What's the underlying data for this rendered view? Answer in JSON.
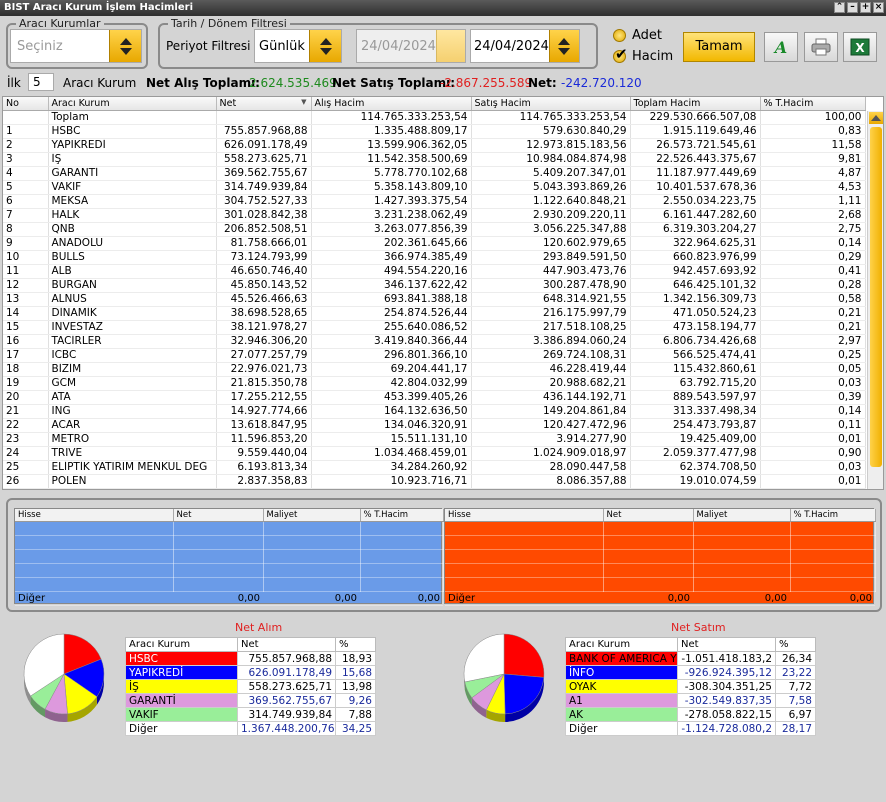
{
  "window": {
    "title": "BIST Aracı Kurum İşlem Hacimleri"
  },
  "brokers_group": {
    "legend": "Aracı Kurumlar",
    "combo_value": "Seçiniz"
  },
  "date_group": {
    "legend": "Tarih / Dönem Filtresi",
    "period_label": "Periyot Filtresi",
    "period_value": "Günlük",
    "date_from": "24/04/2024",
    "date_to": "24/04/2024"
  },
  "options": {
    "adet_label": "Adet",
    "hacim_label": "Hacim",
    "selected": "Hacim"
  },
  "toolbar": {
    "ok_label": "Tamam",
    "font_icon": "A",
    "print_icon": "printer-icon",
    "excel_icon": "excel-icon"
  },
  "info": {
    "ilk_label": "İlk",
    "ilk_value": "5",
    "broker_label": "Aracı Kurum",
    "net_buy_label": "Net Alış Toplamı:",
    "net_buy_value": "2.624.535.469",
    "net_sell_label": "Net Satış Toplamı:",
    "net_sell_value": "-2.867.255.589",
    "net_label": "Net:",
    "net_value": "-242.720.120"
  },
  "colors": {
    "buy": "#1e8a1e",
    "sell": "#e02020",
    "net": "#1a2ad8",
    "blue_panel": "#6a9be8",
    "orange_panel": "#ff4a00"
  },
  "grid": {
    "headers": [
      "No",
      "Aracı Kurum",
      "Net",
      "Alış Hacim",
      "Satış Hacim",
      "Toplam Hacim",
      "% T.Hacim"
    ],
    "rows": [
      [
        "",
        "Toplam",
        "",
        "114.765.333.253,54",
        "114.765.333.253,54",
        "229.530.666.507,08",
        "100,00"
      ],
      [
        "1",
        "HSBC",
        "755.857.968,88",
        "1.335.488.809,17",
        "579.630.840,29",
        "1.915.119.649,46",
        "0,83"
      ],
      [
        "2",
        "YAPIKREDİ",
        "626.091.178,49",
        "13.599.906.362,05",
        "12.973.815.183,56",
        "26.573.721.545,61",
        "11,58"
      ],
      [
        "3",
        "İŞ",
        "558.273.625,71",
        "11.542.358.500,69",
        "10.984.084.874,98",
        "22.526.443.375,67",
        "9,81"
      ],
      [
        "4",
        "GARANTİ",
        "369.562.755,67",
        "5.778.770.102,68",
        "5.409.207.347,01",
        "11.187.977.449,69",
        "4,87"
      ],
      [
        "5",
        "VAKIF",
        "314.749.939,84",
        "5.358.143.809,10",
        "5.043.393.869,26",
        "10.401.537.678,36",
        "4,53"
      ],
      [
        "6",
        "MEKSA",
        "304.752.527,33",
        "1.427.393.375,54",
        "1.122.640.848,21",
        "2.550.034.223,75",
        "1,11"
      ],
      [
        "7",
        "HALK",
        "301.028.842,38",
        "3.231.238.062,49",
        "2.930.209.220,11",
        "6.161.447.282,60",
        "2,68"
      ],
      [
        "8",
        "QNB",
        "206.852.508,51",
        "3.263.077.856,39",
        "3.056.225.347,88",
        "6.319.303.204,27",
        "2,75"
      ],
      [
        "9",
        "ANADOLU",
        "81.758.666,01",
        "202.361.645,66",
        "120.602.979,65",
        "322.964.625,31",
        "0,14"
      ],
      [
        "10",
        "BULLS",
        "73.124.793,99",
        "366.974.385,49",
        "293.849.591,50",
        "660.823.976,99",
        "0,29"
      ],
      [
        "11",
        "ALB",
        "46.650.746,40",
        "494.554.220,16",
        "447.903.473,76",
        "942.457.693,92",
        "0,41"
      ],
      [
        "12",
        "BURGAN",
        "45.850.143,52",
        "346.137.622,42",
        "300.287.478,90",
        "646.425.101,32",
        "0,28"
      ],
      [
        "13",
        "ALNUS",
        "45.526.466,63",
        "693.841.388,18",
        "648.314.921,55",
        "1.342.156.309,73",
        "0,58"
      ],
      [
        "14",
        "DİNAMİK",
        "38.698.528,65",
        "254.874.526,44",
        "216.175.997,79",
        "471.050.524,23",
        "0,21"
      ],
      [
        "15",
        "INVESTAZ",
        "38.121.978,27",
        "255.640.086,52",
        "217.518.108,25",
        "473.158.194,77",
        "0,21"
      ],
      [
        "16",
        "TACİRLER",
        "32.946.306,20",
        "3.419.840.366,44",
        "3.386.894.060,24",
        "6.806.734.426,68",
        "2,97"
      ],
      [
        "17",
        "ICBC",
        "27.077.257,79",
        "296.801.366,10",
        "269.724.108,31",
        "566.525.474,41",
        "0,25"
      ],
      [
        "18",
        "BİZİM",
        "22.976.021,73",
        "69.204.441,17",
        "46.228.419,44",
        "115.432.860,61",
        "0,05"
      ],
      [
        "19",
        "GCM",
        "21.815.350,78",
        "42.804.032,99",
        "20.988.682,21",
        "63.792.715,20",
        "0,03"
      ],
      [
        "20",
        "ATA",
        "17.255.212,55",
        "453.399.405,26",
        "436.144.192,71",
        "889.543.597,97",
        "0,39"
      ],
      [
        "21",
        "ING",
        "14.927.774,66",
        "164.132.636,50",
        "149.204.861,84",
        "313.337.498,34",
        "0,14"
      ],
      [
        "22",
        "ACAR",
        "13.618.847,95",
        "134.046.320,91",
        "120.427.472,96",
        "254.473.793,87",
        "0,11"
      ],
      [
        "23",
        "METRO",
        "11.596.853,20",
        "15.511.131,10",
        "3.914.277,90",
        "19.425.409,00",
        "0,01"
      ],
      [
        "24",
        "TRIVE",
        "9.559.440,04",
        "1.034.468.459,01",
        "1.024.909.018,97",
        "2.059.377.477,98",
        "0,90"
      ],
      [
        "25",
        "ELİPTİK YATIRIM MENKUL DEĞ",
        "6.193.813,34",
        "34.284.260,92",
        "28.090.447,58",
        "62.374.708,50",
        "0,03"
      ],
      [
        "26",
        "POLEN",
        "2.837.358,83",
        "10.923.716,71",
        "8.086.357,88",
        "19.010.074,59",
        "0,01"
      ]
    ]
  },
  "stock_grid_left": {
    "headers": [
      "Hisse",
      "Net",
      "Maliyet",
      "% T.Hacim"
    ],
    "footer": [
      "Diğer",
      "0,00",
      "0,00",
      "0,00"
    ]
  },
  "stock_grid_right": {
    "headers": [
      "Hisse",
      "Net",
      "Maliyet",
      "% T.Hacim"
    ],
    "footer": [
      "Diğer",
      "0,00",
      "0,00",
      "0,00"
    ]
  },
  "net_buy": {
    "title": "Net Alım",
    "headers": [
      "Aracı Kurum",
      "Net",
      "%"
    ],
    "rows": [
      {
        "name": "HSBC",
        "net": "755.857.968,88",
        "pct": "18,93",
        "color": "#ff0000",
        "text": "#ffffff"
      },
      {
        "name": "YAPIKREDİ",
        "net": "626.091.178,49",
        "pct": "15,68",
        "color": "#0000ff",
        "text": "#ffffff"
      },
      {
        "name": "İŞ",
        "net": "558.273.625,71",
        "pct": "13,98",
        "color": "#ffff00",
        "text": "#000000"
      },
      {
        "name": "GARANTİ",
        "net": "369.562.755,67",
        "pct": "9,26",
        "color": "#dd99dd",
        "text": "#000000"
      },
      {
        "name": "VAKIF",
        "net": "314.749.939,84",
        "pct": "7,88",
        "color": "#99ee99",
        "text": "#000000"
      },
      {
        "name": "Diğer",
        "net": "1.367.448.200,76",
        "pct": "34,25",
        "color": "#ffffff",
        "text": "#000000"
      }
    ]
  },
  "net_sell": {
    "title": "Net Satım",
    "headers": [
      "Aracı Kurum",
      "Net",
      "%"
    ],
    "rows": [
      {
        "name": "BANK OF AMERICA Y",
        "net": "-1.051.418.183,2",
        "pct": "26,34",
        "color": "#ff0000",
        "text": "#000000"
      },
      {
        "name": "İNFO",
        "net": "-926.924.395,12",
        "pct": "23,22",
        "color": "#0000ff",
        "text": "#ffffff"
      },
      {
        "name": "OYAK",
        "net": "-308.304.351,25",
        "pct": "7,72",
        "color": "#ffff00",
        "text": "#000000"
      },
      {
        "name": "A1",
        "net": "-302.549.837,35",
        "pct": "7,58",
        "color": "#dd99dd",
        "text": "#000000"
      },
      {
        "name": "AK",
        "net": "-278.058.822,15",
        "pct": "6,97",
        "color": "#99ee99",
        "text": "#000000"
      },
      {
        "name": "Diğer",
        "net": "-1.124.728.080,2",
        "pct": "28,17",
        "color": "#ffffff",
        "text": "#000000"
      }
    ]
  }
}
